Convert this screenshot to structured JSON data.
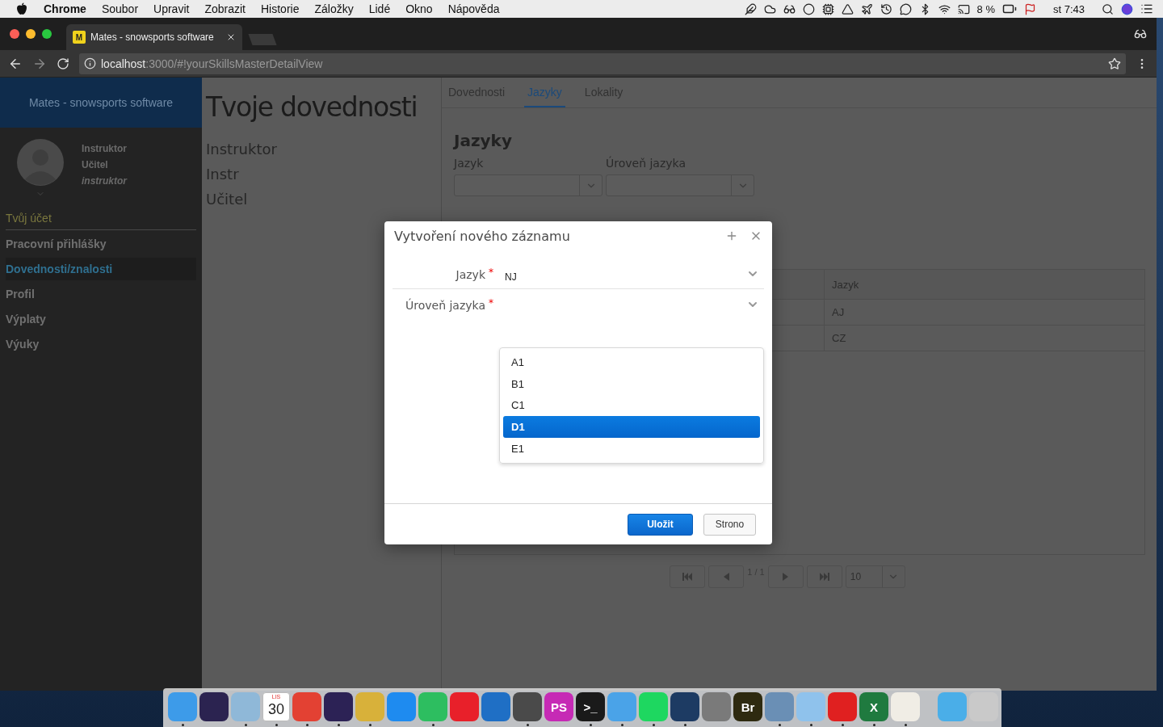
{
  "menu_bar": {
    "app": "Chrome",
    "items": [
      "Soubor",
      "Upravit",
      "Zobrazit",
      "Historie",
      "Záložky",
      "Lidé",
      "Okno",
      "Nápověda"
    ],
    "battery": "8 %",
    "clock": "st 7:43"
  },
  "browser": {
    "tab": {
      "favicon": "M",
      "title": "Mates - snowsports software"
    },
    "url_host": "localhost",
    "url_path": ":3000/#!yourSkillsMasterDetailView"
  },
  "sidebar": {
    "brand": "Mates - snowsports software",
    "user_lines": [
      {
        "text": "Instruktor",
        "kind": "name"
      },
      {
        "text": "Učitel",
        "kind": "name"
      },
      {
        "text": "instruktor",
        "kind": "role"
      }
    ],
    "section": "Tvůj účet",
    "items": [
      {
        "label": "Pracovní přihlášky",
        "selected": false
      },
      {
        "label": "Dovednosti/znalosti",
        "selected": true
      },
      {
        "label": "Profil",
        "selected": false
      },
      {
        "label": "Výplaty",
        "selected": false
      },
      {
        "label": "Výuky",
        "selected": false
      }
    ]
  },
  "page": {
    "title": "Tvoje dovednosti",
    "lines": [
      "Instruktor",
      "Instr",
      "Učitel"
    ]
  },
  "panel": {
    "tabs": [
      {
        "label": "Dovednosti",
        "selected": false
      },
      {
        "label": "Jazyky",
        "selected": true
      },
      {
        "label": "Lokality",
        "selected": false
      }
    ],
    "heading": "Jazyky",
    "filters": [
      {
        "label": "Jazyk"
      },
      {
        "label": "Úroveň jazyka"
      }
    ],
    "table": {
      "columns": [
        "Jazyk"
      ],
      "rows": [
        [
          "AJ"
        ],
        [
          "CZ"
        ]
      ]
    },
    "pagination": {
      "page": "1 / 1",
      "page_size": "10"
    }
  },
  "dialog": {
    "title": "Vytvoření nového záznamu",
    "fields": [
      {
        "label": "Jazyk",
        "required_mark": "*",
        "value": "NJ"
      },
      {
        "label": "Úroveň jazyka",
        "required_mark": "*"
      }
    ],
    "options": [
      {
        "label": "A1",
        "selected": false
      },
      {
        "label": "B1",
        "selected": false
      },
      {
        "label": "C1",
        "selected": false
      },
      {
        "label": "D1",
        "selected": true
      },
      {
        "label": "E1",
        "selected": false
      }
    ],
    "buttons": [
      {
        "label": "Uložit",
        "kind": "primary"
      },
      {
        "label": "Strono",
        "kind": "secondary"
      }
    ]
  },
  "dock": {
    "items": [
      {
        "kind": "app",
        "color": "#3d9be9",
        "running": true
      },
      {
        "kind": "app",
        "color": "#2b2350",
        "running": false
      },
      {
        "kind": "app",
        "color": "#8fb8d8",
        "running": true
      },
      {
        "kind": "calendar",
        "color": "#ffffff",
        "running": true,
        "month": "LIS",
        "text": "30"
      },
      {
        "kind": "app",
        "color": "#e34133",
        "running": true
      },
      {
        "kind": "app",
        "color": "#2c2255",
        "running": true
      },
      {
        "kind": "app",
        "color": "#d8b13a",
        "running": true
      },
      {
        "kind": "app",
        "color": "#1e8bf0",
        "running": false
      },
      {
        "kind": "app",
        "color": "#2dbe60",
        "running": true
      },
      {
        "kind": "app",
        "color": "#e8202a",
        "running": false
      },
      {
        "kind": "app",
        "color": "#1f6fc5",
        "running": false
      },
      {
        "kind": "app",
        "color": "#4a4a4a",
        "running": true
      },
      {
        "kind": "app",
        "color": "#c62ab5",
        "running": false,
        "text": "PS"
      },
      {
        "kind": "app",
        "color": "#1a1a1a",
        "running": true,
        "text": ">_"
      },
      {
        "kind": "app",
        "color": "#4aa3e8",
        "running": true
      },
      {
        "kind": "app",
        "color": "#1ed760",
        "running": true
      },
      {
        "kind": "app",
        "color": "#1d3b63",
        "running": true
      },
      {
        "kind": "app",
        "color": "#7a7a7a",
        "running": false
      },
      {
        "kind": "app",
        "color": "#2e2a10",
        "running": false,
        "text": "Br"
      },
      {
        "kind": "app",
        "color": "#6a8fb5",
        "running": true
      },
      {
        "kind": "app",
        "color": "#8fc2ec",
        "running": true
      },
      {
        "kind": "app",
        "color": "#e02020",
        "running": true
      },
      {
        "kind": "app",
        "color": "#1f7a3f",
        "running": true,
        "text": "X"
      },
      {
        "kind": "app",
        "color": "#f0ede5",
        "running": true
      },
      {
        "kind": "separator"
      },
      {
        "kind": "app",
        "color": "#4aaee8",
        "running": false
      },
      {
        "kind": "app",
        "color": "#c9c9c9",
        "running": false
      }
    ]
  }
}
